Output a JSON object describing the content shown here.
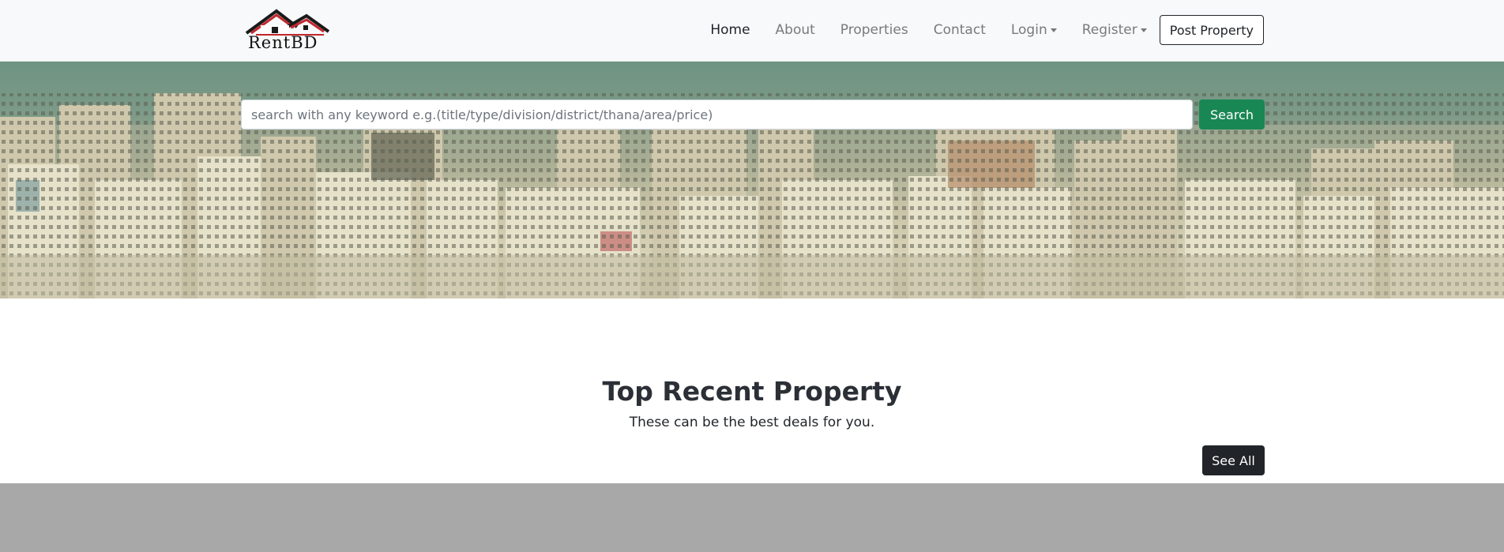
{
  "brand": {
    "logo_text": "RentBD",
    "logo_icon": "house-roof-icon",
    "colors": {
      "roof_red": "#c1272d",
      "roof_dark": "#1a1a1a"
    }
  },
  "nav": {
    "items": [
      {
        "label": "Home",
        "active": true
      },
      {
        "label": "About"
      },
      {
        "label": "Properties"
      },
      {
        "label": "Contact"
      },
      {
        "label": "Login",
        "dropdown": true
      },
      {
        "label": "Register",
        "dropdown": true
      }
    ],
    "post_property_label": "Post Property"
  },
  "hero": {
    "search_placeholder": "search with any keyword e.g.(title/type/division/district/thana/area/price)",
    "search_value": "",
    "search_button_label": "Search",
    "colors": {
      "search_button": "#198754"
    }
  },
  "recent": {
    "title": "Top Recent Property",
    "subtitle": "These can be the best deals for you.",
    "see_all_label": "See All"
  }
}
